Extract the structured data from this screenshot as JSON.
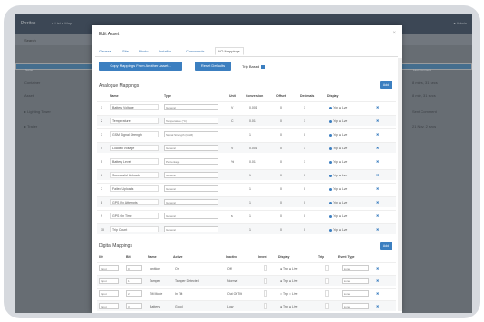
{
  "background": {
    "app_logo": "Pozitas",
    "top_nav": "● List  ● Map",
    "top_right": "● Admin",
    "search_label": "Search",
    "rows": [
      {
        "left": "Name",
        "right": "Last Comment",
        "selected": true
      },
      {
        "left": "Container",
        "right": "8 mins, 31 secs",
        "selected": false
      },
      {
        "left": "Asset",
        "right": "8 min, 31 secs",
        "selected": false
      },
      {
        "left": "▸ Lighting Tower",
        "right": "Sent Comment",
        "selected": false
      },
      {
        "left": "▸ Trailer",
        "right": "21 Nov, 2 secs",
        "selected": false
      }
    ]
  },
  "modal": {
    "title": "Edit Asset",
    "close": "×",
    "tabs": [
      "General",
      "Site",
      "Photo",
      "Installer",
      "Commands",
      "I/O Mappings"
    ],
    "copy_button": "Copy Mappings From Another Asset...",
    "reset_button": "Reset Defaults",
    "trip_based_label": "Trip Based",
    "analogue": {
      "title": "Analogue Mappings",
      "add": "Add",
      "headers": [
        "Name",
        "Type",
        "Unit",
        "Conversion",
        "Offset",
        "Decimals",
        "Display"
      ],
      "rows": [
        {
          "n": "1",
          "name": "Battery Voltage",
          "type": "General",
          "unit": "V",
          "conv": "0.001",
          "off": "0",
          "dec": "1",
          "disp": "Trip ● Live"
        },
        {
          "n": "2",
          "name": "Temperature",
          "type": "Temperature (°C)",
          "unit": "C",
          "conv": "0.01",
          "off": "0",
          "dec": "1",
          "disp": "Trip ● Live"
        },
        {
          "n": "3",
          "name": "GSM Signal Strength",
          "type": "Signal Strength (GSM)",
          "unit": "",
          "conv": "1",
          "off": "0",
          "dec": "0",
          "disp": "Trip ● Live"
        },
        {
          "n": "4",
          "name": "Loaded Voltage",
          "type": "General",
          "unit": "V",
          "conv": "0.001",
          "off": "0",
          "dec": "1",
          "disp": "Trip ● Live"
        },
        {
          "n": "5",
          "name": "Battery Level",
          "type": "Percentage",
          "unit": "%",
          "conv": "0.01",
          "off": "0",
          "dec": "1",
          "disp": "Trip ● Live"
        },
        {
          "n": "6",
          "name": "Successful Uploads",
          "type": "General",
          "unit": "",
          "conv": "1",
          "off": "0",
          "dec": "0",
          "disp": "Trip ● Live"
        },
        {
          "n": "7",
          "name": "Failed Uploads",
          "type": "General",
          "unit": "",
          "conv": "1",
          "off": "0",
          "dec": "0",
          "disp": "Trip ● Live"
        },
        {
          "n": "8",
          "name": "GPS Fix Attempts",
          "type": "General",
          "unit": "",
          "conv": "1",
          "off": "0",
          "dec": "0",
          "disp": "Trip ● Live"
        },
        {
          "n": "9",
          "name": "GPS On Time",
          "type": "General",
          "unit": "s",
          "conv": "1",
          "off": "0",
          "dec": "0",
          "disp": "Trip ● Live"
        },
        {
          "n": "10",
          "name": "Trip Count",
          "type": "General",
          "unit": "",
          "conv": "1",
          "off": "0",
          "dec": "0",
          "disp": "Trip ● Live"
        }
      ]
    },
    "digital": {
      "title": "Digital Mappings",
      "add": "Add",
      "headers": [
        "I/O",
        "Bit",
        "Name",
        "Active",
        "Inactive",
        "Invert",
        "Display",
        "Trip",
        "Event Type"
      ],
      "rows": [
        {
          "io": "Input",
          "bit": "0",
          "name": "Ignition",
          "active": "On",
          "inactive": "Off",
          "inv": "",
          "disp": "● Trip ● Live",
          "evt": "None"
        },
        {
          "io": "Input",
          "bit": "1",
          "name": "Tamper",
          "active": "Tamper Detected",
          "inactive": "Normal",
          "inv": "",
          "disp": "● Trip ● Live",
          "evt": "None"
        },
        {
          "io": "Input",
          "bit": "2",
          "name": "Tilt Mode",
          "active": "In Tilt",
          "inactive": "Out Of Tilt",
          "inv": "",
          "disp": "○ Trip ○ Live",
          "evt": "None"
        },
        {
          "io": "Input",
          "bit": "3",
          "name": "Battery",
          "active": "Good",
          "inactive": "Low",
          "inv": "",
          "disp": "● Trip ● Live",
          "evt": "None"
        }
      ]
    }
  },
  "colors": {
    "accent": "#3c7fc0",
    "selected_row": "#4b86b4",
    "topbar": "#3c4a5c"
  }
}
